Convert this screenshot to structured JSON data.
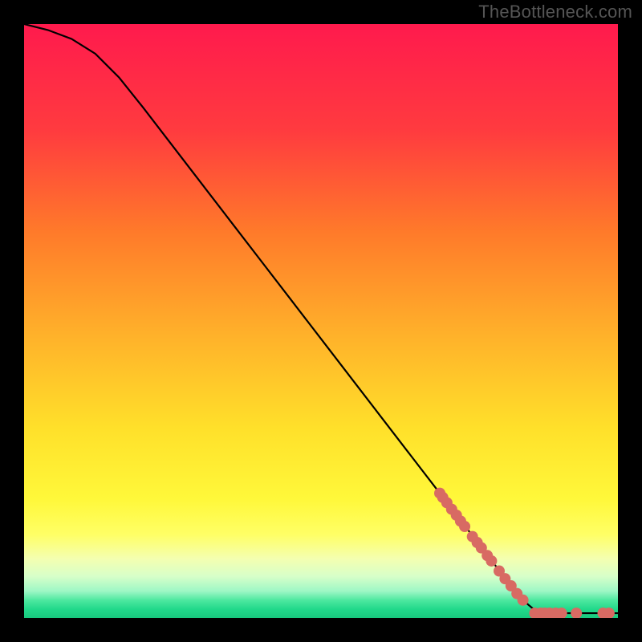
{
  "watermark": "TheBottleneck.com",
  "chart_data": {
    "type": "line",
    "title": "",
    "xlabel": "",
    "ylabel": "",
    "xlim": [
      0,
      100
    ],
    "ylim": [
      0,
      100
    ],
    "curve": [
      {
        "x": 0,
        "y": 100
      },
      {
        "x": 4,
        "y": 99
      },
      {
        "x": 8,
        "y": 97.5
      },
      {
        "x": 12,
        "y": 95
      },
      {
        "x": 16,
        "y": 91
      },
      {
        "x": 20,
        "y": 86
      },
      {
        "x": 25,
        "y": 79.5
      },
      {
        "x": 30,
        "y": 73
      },
      {
        "x": 35,
        "y": 66.5
      },
      {
        "x": 40,
        "y": 60
      },
      {
        "x": 45,
        "y": 53.5
      },
      {
        "x": 50,
        "y": 47
      },
      {
        "x": 55,
        "y": 40.5
      },
      {
        "x": 60,
        "y": 34
      },
      {
        "x": 65,
        "y": 27.5
      },
      {
        "x": 70,
        "y": 21
      },
      {
        "x": 75,
        "y": 14.5
      },
      {
        "x": 80,
        "y": 8
      },
      {
        "x": 84,
        "y": 3
      },
      {
        "x": 86,
        "y": 1.3
      },
      {
        "x": 88,
        "y": 0.8
      },
      {
        "x": 92,
        "y": 0.8
      },
      {
        "x": 96,
        "y": 0.8
      },
      {
        "x": 100,
        "y": 0.8
      }
    ],
    "marker_thresholds": {
      "segment_max_x": 86,
      "tail_min_x": 86
    },
    "markers": [
      {
        "x": 70.0,
        "y": 21.0
      },
      {
        "x": 70.5,
        "y": 20.3
      },
      {
        "x": 71.2,
        "y": 19.4
      },
      {
        "x": 72.0,
        "y": 18.3
      },
      {
        "x": 72.8,
        "y": 17.3
      },
      {
        "x": 73.5,
        "y": 16.3
      },
      {
        "x": 74.2,
        "y": 15.4
      },
      {
        "x": 75.5,
        "y": 13.7
      },
      {
        "x": 76.3,
        "y": 12.7
      },
      {
        "x": 77.0,
        "y": 11.8
      },
      {
        "x": 78.0,
        "y": 10.5
      },
      {
        "x": 78.7,
        "y": 9.6
      },
      {
        "x": 80.0,
        "y": 7.9
      },
      {
        "x": 81.0,
        "y": 6.6
      },
      {
        "x": 82.0,
        "y": 5.4
      },
      {
        "x": 83.0,
        "y": 4.1
      },
      {
        "x": 84.0,
        "y": 3.0
      },
      {
        "x": 86.0,
        "y": 0.8
      },
      {
        "x": 87.0,
        "y": 0.8
      },
      {
        "x": 87.7,
        "y": 0.8
      },
      {
        "x": 88.5,
        "y": 0.8
      },
      {
        "x": 89.5,
        "y": 0.8
      },
      {
        "x": 90.5,
        "y": 0.8
      },
      {
        "x": 93.0,
        "y": 0.8
      },
      {
        "x": 97.5,
        "y": 0.8
      },
      {
        "x": 98.5,
        "y": 0.8
      }
    ],
    "gradient_stops": [
      {
        "pct": 0,
        "color": "#ff1a4d"
      },
      {
        "pct": 18,
        "color": "#ff3b3f"
      },
      {
        "pct": 35,
        "color": "#ff7a2a"
      },
      {
        "pct": 52,
        "color": "#ffb02a"
      },
      {
        "pct": 68,
        "color": "#ffe02a"
      },
      {
        "pct": 80,
        "color": "#fff83a"
      },
      {
        "pct": 86,
        "color": "#ffff66"
      },
      {
        "pct": 90,
        "color": "#f4ffb0"
      },
      {
        "pct": 93,
        "color": "#d7ffc9"
      },
      {
        "pct": 95.5,
        "color": "#9df7c5"
      },
      {
        "pct": 97,
        "color": "#4ee8a0"
      },
      {
        "pct": 98.5,
        "color": "#22d98b"
      },
      {
        "pct": 100,
        "color": "#18c97e"
      }
    ],
    "curve_color": "#000000",
    "marker_color": "#d86a63",
    "marker_radius": 7
  }
}
